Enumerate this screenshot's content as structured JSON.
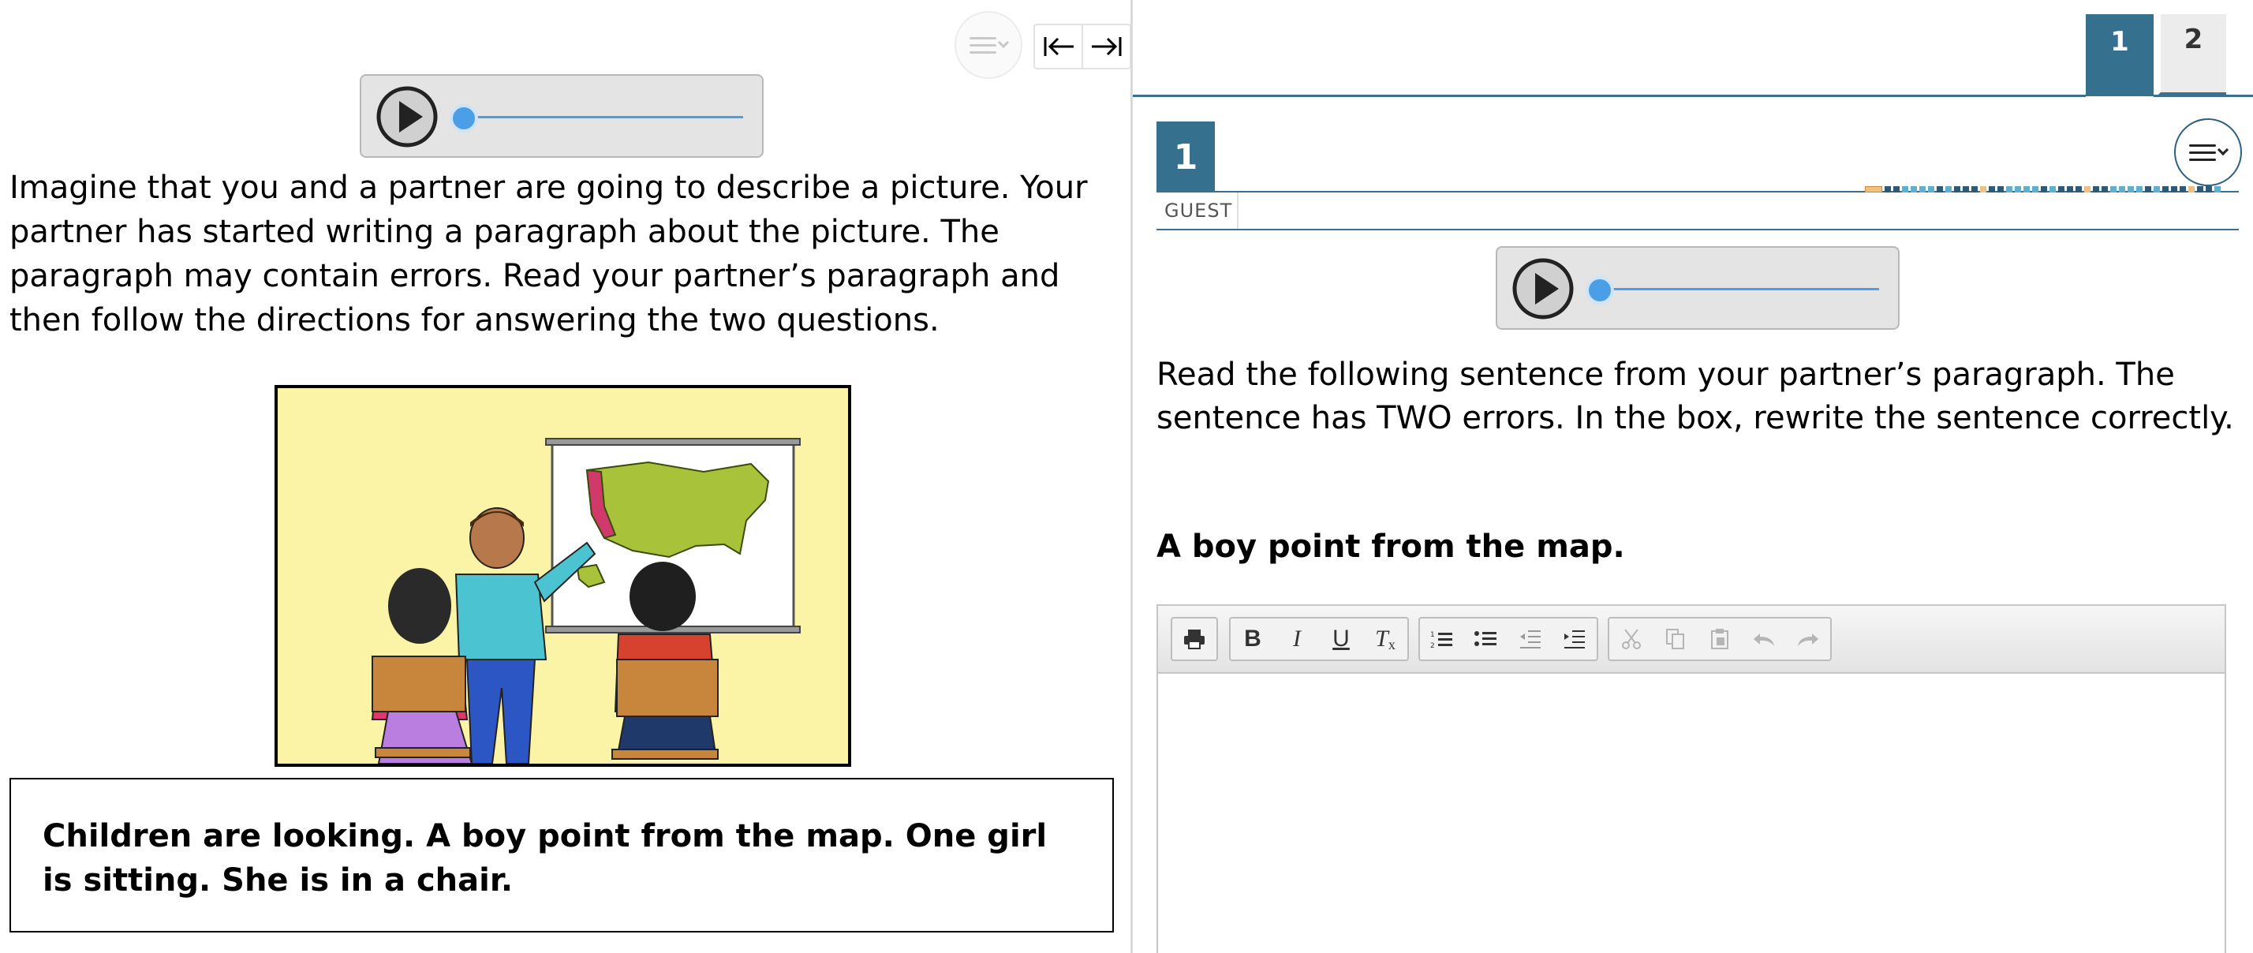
{
  "stimulus": {
    "intro": "Imagine that you and a partner are going to describe a picture. Your partner has started writing a paragraph about the picture. The paragraph may contain errors. Read your partner’s paragraph and then follow the directions for answering the two questions.",
    "paragraph": "Children are looking. A boy point from the map. One girl is sitting. She is in a chair."
  },
  "tabs": [
    {
      "label": "1",
      "active": true
    },
    {
      "label": "2",
      "active": false
    }
  ],
  "question": {
    "number": "1",
    "user_label": "GUEST",
    "prompt": "Read the following sentence from your partner’s paragraph. The sentence has TWO errors. In the box, rewrite the sentence correctly.",
    "sentence": "A boy point from the map."
  },
  "editor": {
    "toolbar_groups": [
      [
        "print-icon"
      ],
      [
        "bold-icon",
        "italic-icon",
        "underline-icon",
        "clear-format-icon"
      ],
      [
        "numbered-list-icon",
        "bullet-list-icon",
        "outdent-icon",
        "indent-icon"
      ],
      [
        "cut-icon",
        "copy-icon",
        "paste-icon",
        "undo-icon",
        "redo-icon"
      ]
    ],
    "value": ""
  },
  "colors": {
    "accent": "#35708f",
    "audio_track": "#4a9fe6",
    "picture_background": "#fbf3a6"
  }
}
